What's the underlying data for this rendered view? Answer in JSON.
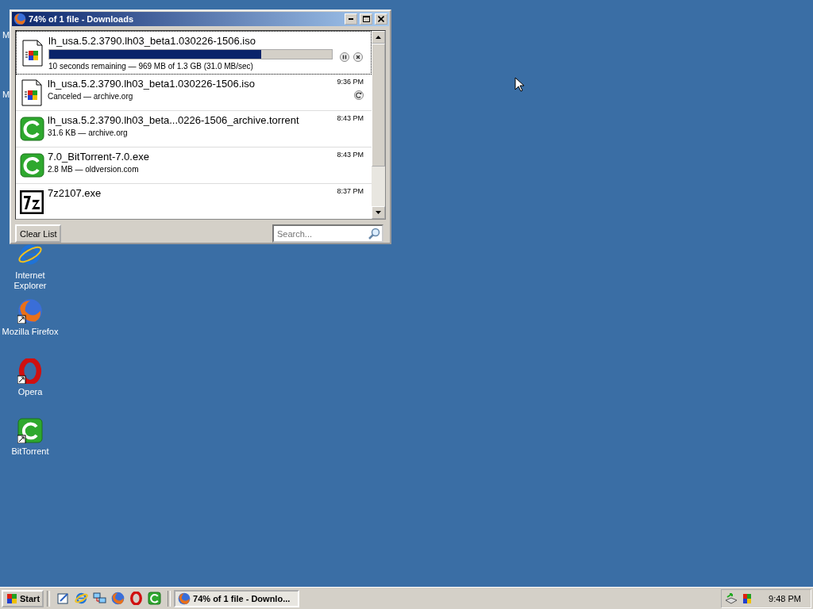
{
  "desktop": {
    "icons": [
      {
        "label": "M",
        "kind": "hidden"
      },
      {
        "label": "M",
        "kind": "hidden"
      },
      {
        "label": "Internet Explorer",
        "kind": "ie",
        "shortcut": false
      },
      {
        "label": "Mozilla Firefox",
        "kind": "firefox",
        "shortcut": true
      },
      {
        "label": "Opera",
        "kind": "opera",
        "shortcut": true
      },
      {
        "label": "BitTorrent",
        "kind": "bittorrent",
        "shortcut": true
      }
    ]
  },
  "window": {
    "title": "74% of 1 file - Downloads",
    "downloads": [
      {
        "name": "lh_usa.5.2.3790.lh03_beta1.030226-1506.iso",
        "status": "10 seconds remaining — 969 MB of 1.3 GB (31.0 MB/sec)",
        "kind": "iso",
        "canceled": false,
        "level": 0.75,
        "selected": true
      },
      {
        "name": "lh_usa.5.2.3790.lh03_beta1.030226-1506.iso",
        "status": "Canceled — archive.org",
        "time": "9:36 PM",
        "kind": "iso",
        "canceled": true,
        "selected": false
      },
      {
        "name": "lh_usa.5.2.3790.lh03_beta...0226-1506_archive.torrent",
        "status": "31.6 KB — archive.org",
        "time": "8:43 PM",
        "kind": "torrent",
        "canceled": false,
        "selected": false
      },
      {
        "name": "7.0_BitTorrent-7.0.exe",
        "status": "2.8 MB — oldversion.com",
        "time": "8:43 PM",
        "kind": "torrent",
        "canceled": false,
        "selected": false
      },
      {
        "name": "7z2107.exe",
        "time": "8:37 PM",
        "kind": "sevenzip",
        "canceled": false,
        "selected": false
      }
    ],
    "clear_button": "Clear List",
    "search": {
      "placeholder": "Search..."
    }
  },
  "taskbar": {
    "start": "Start",
    "quick_launch": [
      {
        "kind": "notepad"
      },
      {
        "kind": "ie"
      },
      {
        "kind": "network"
      },
      {
        "kind": "firefox"
      },
      {
        "kind": "opera"
      },
      {
        "kind": "bittorrent"
      }
    ],
    "tasks": [
      {
        "label": "74% of 1 file - Downlo...",
        "selected": true
      }
    ],
    "clock": "9:48 PM"
  }
}
